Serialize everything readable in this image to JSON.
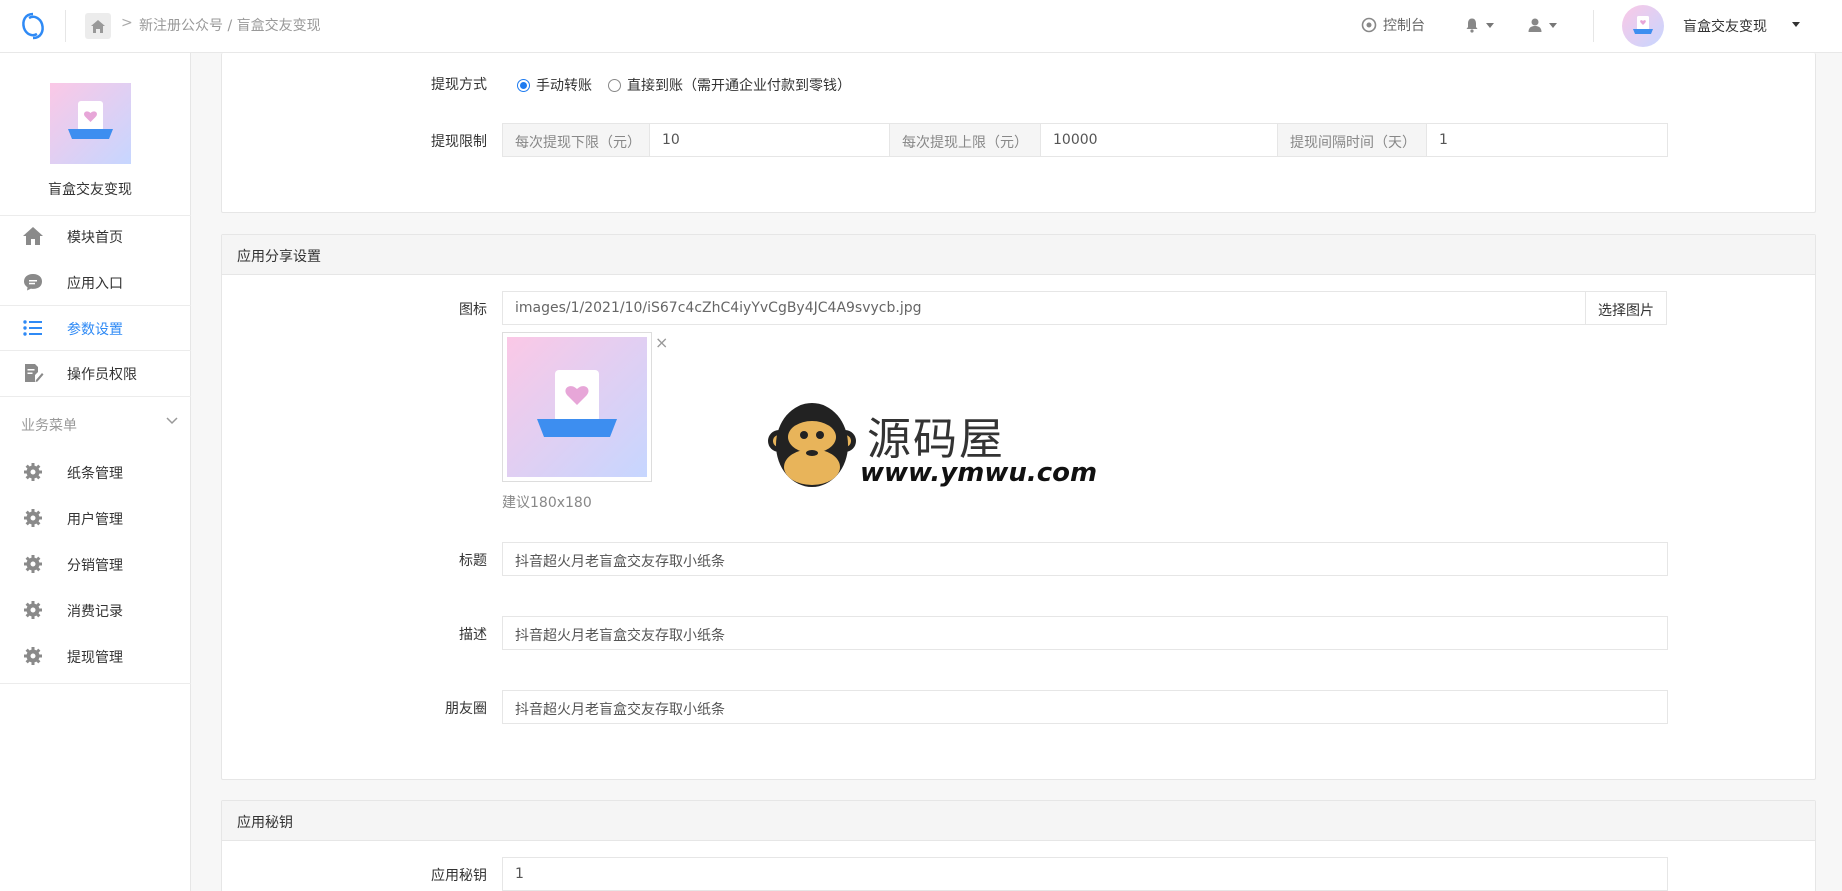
{
  "header": {
    "breadcrumb_sep": ">",
    "breadcrumb": "新注册公众号 / 盲盒交友变现",
    "console_label": "控制台",
    "account_name": "盲盒交友变现"
  },
  "sidebar": {
    "app_name": "盲盒交友变现",
    "items": [
      {
        "label": "模块首页",
        "icon": "home-icon"
      },
      {
        "label": "应用入口",
        "icon": "chat-bubble-icon"
      },
      {
        "label": "参数设置",
        "icon": "list-icon",
        "active": true
      },
      {
        "label": "操作员权限",
        "icon": "edit-doc-icon"
      }
    ],
    "section_title": "业务菜单",
    "business_items": [
      {
        "label": "纸条管理",
        "icon": "gear-icon"
      },
      {
        "label": "用户管理",
        "icon": "gear-icon"
      },
      {
        "label": "分销管理",
        "icon": "gear-icon"
      },
      {
        "label": "消费记录",
        "icon": "gear-icon"
      },
      {
        "label": "提现管理",
        "icon": "gear-icon"
      }
    ]
  },
  "withdraw": {
    "method_label": "提现方式",
    "method_options": [
      "手动转账",
      "直接到账（需开通企业付款到零钱）"
    ],
    "method_selected": "手动转账",
    "limit_label": "提现限制",
    "min_label": "每次提现下限（元）",
    "min_value": "10",
    "max_label": "每次提现上限（元）",
    "max_value": "10000",
    "interval_label": "提现间隔时间（天）",
    "interval_value": "1"
  },
  "share": {
    "section_title": "应用分享设置",
    "icon_label": "图标",
    "icon_path": "images/1/2021/10/iS67c4cZhC4iyYvCgBy4JC4A9svycb.jpg",
    "pick_button": "选择图片",
    "close_glyph": "×",
    "size_hint": "建议180x180",
    "title_label": "标题",
    "title_value": "抖音超火月老盲盒交友存取小纸条",
    "desc_label": "描述",
    "desc_value": "抖音超火月老盲盒交友存取小纸条",
    "moments_label": "朋友圈",
    "moments_value": "抖音超火月老盲盒交友存取小纸条"
  },
  "secret": {
    "section_title": "应用秘钥",
    "label": "应用秘钥",
    "value": "1"
  },
  "watermark": {
    "text": "源码屋",
    "url": "www.ymwu.com"
  },
  "colors": {
    "accent": "#2f8af5",
    "icon_gray": "#8a8a8a"
  }
}
